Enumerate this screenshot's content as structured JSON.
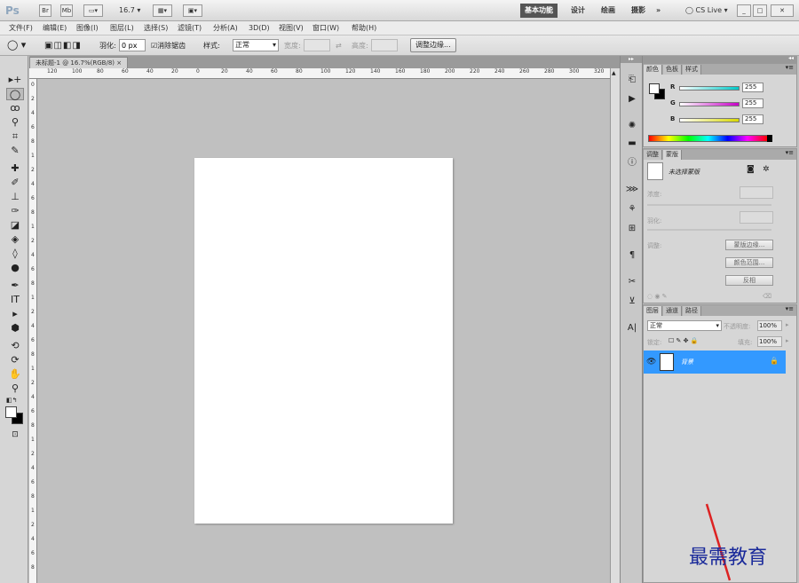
{
  "app": {
    "logo": "Ps",
    "bridge_label": "Br",
    "minibridge_label": "Mb",
    "zoom_value": "16.7",
    "workspaces": [
      "基本功能",
      "设计",
      "绘画",
      "摄影"
    ],
    "more_label": "»",
    "cslive_label": "CS Live"
  },
  "menu": [
    "文件(F)",
    "编辑(E)",
    "图像(I)",
    "图层(L)",
    "选择(S)",
    "滤镜(T)",
    "分析(A)",
    "3D(D)",
    "视图(V)",
    "窗口(W)",
    "帮助(H)"
  ],
  "options": {
    "feather_label": "羽化:",
    "feather_value": "0 px",
    "antialias_label": "消除锯齿",
    "style_label": "样式:",
    "style_value": "正常",
    "width_label": "宽度:",
    "height_label": "高度:",
    "refine_edge_label": "调整边缘..."
  },
  "document": {
    "tab_title": "未标题-1 @ 16.7%(RGB/8)",
    "close_glyph": "×"
  },
  "ruler": {
    "h_labels": [
      "120",
      "100",
      "80",
      "60",
      "40",
      "20",
      "0",
      "20",
      "40",
      "60",
      "80",
      "100",
      "120",
      "140",
      "160",
      "180",
      "200",
      "220",
      "240",
      "260",
      "280",
      "300",
      "320"
    ],
    "v_labels": [
      "0",
      "2",
      "4",
      "6",
      "8",
      "1",
      "2",
      "4",
      "6",
      "8",
      "1",
      "2",
      "4",
      "6",
      "8",
      "1",
      "2",
      "4",
      "6",
      "8",
      "1",
      "2",
      "4",
      "6",
      "8",
      "1",
      "2",
      "4",
      "6",
      "8",
      "1",
      "2",
      "4",
      "6",
      "8"
    ]
  },
  "color_panel": {
    "tabs": [
      "颜色",
      "色板",
      "样式"
    ],
    "r_label": "R",
    "r_value": "255",
    "g_label": "G",
    "g_value": "255",
    "b_label": "B",
    "b_value": "255",
    "r_color": "#00c8c8",
    "g_color": "#c800c8",
    "b_color": "#d8d800"
  },
  "adjust_panel": {
    "tabs": [
      "调整",
      "蒙版"
    ],
    "no_mask": "未选择蒙版",
    "density_label": "浓度:",
    "feather_label": "羽化:",
    "refine_label": "调整:",
    "mask_edge_btn": "蒙版边缘...",
    "color_range_btn": "颜色范围...",
    "invert_btn": "反相"
  },
  "layers_panel": {
    "tabs": [
      "图层",
      "通道",
      "路径"
    ],
    "blend_mode": "正常",
    "opacity_label": "不透明度:",
    "opacity_value": "100%",
    "lock_label": "锁定:",
    "fill_label": "填充:",
    "fill_value": "100%",
    "layer_name": "背景",
    "selection_color": "#3399ff"
  },
  "watermark": "最需教育"
}
